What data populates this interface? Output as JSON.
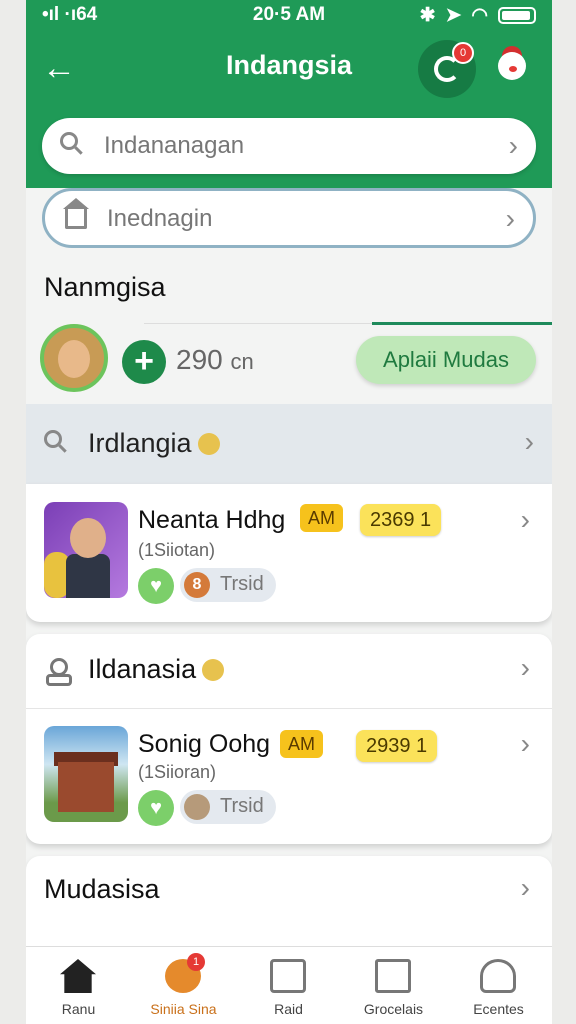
{
  "status": {
    "signal": "•ıl ·ı64",
    "time": "20·5 AM"
  },
  "header": {
    "title": "Indangsia",
    "refresh_badge": "0"
  },
  "search": {
    "primary_placeholder": "Indananagan",
    "secondary_placeholder": "Inednagin"
  },
  "section": {
    "title": "Nanmgisa",
    "count_value": "290",
    "count_unit": "cn",
    "apply_label": "Aplaii Mudas"
  },
  "filter_band": {
    "label": "Irdlangia"
  },
  "items": [
    {
      "name": "Neanta Hdhg",
      "badge": "AM",
      "number": "2369 1",
      "subtitle": "(1Siiotan)",
      "tag_icon": "8",
      "tag": "Trsid"
    },
    {
      "name": "Sonig Oohg",
      "badge": "AM",
      "number": "2939 1",
      "subtitle": "(1Siioran)",
      "tag_icon": "",
      "tag": "Trsid"
    }
  ],
  "card2": {
    "title": "Ildanasia"
  },
  "card3": {
    "title": "Mudasisa"
  },
  "nav": {
    "items": [
      {
        "label": "Ranu"
      },
      {
        "label": "Siniia Sina",
        "badge": "1"
      },
      {
        "label": "Raid"
      },
      {
        "label": "Grocelais"
      },
      {
        "label": "Ecentes"
      }
    ]
  },
  "colors": {
    "brand_green": "#1f9a57",
    "accent_orange": "#c9701a",
    "badge_red": "#e53935"
  }
}
